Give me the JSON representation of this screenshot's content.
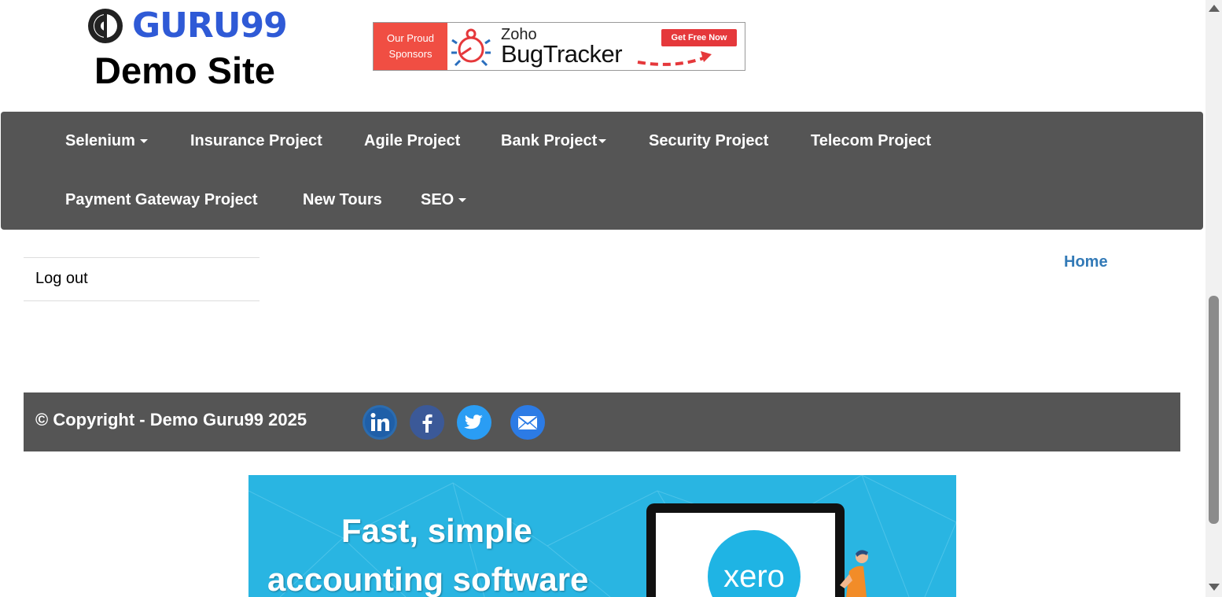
{
  "header": {
    "logo_text": "GURU99",
    "site_title": "Demo Site"
  },
  "sponsor": {
    "line1": "Our Proud",
    "line2": "Sponsors",
    "brand_small": "Zoho",
    "brand_large": "BugTracker",
    "cta": "Get Free Now"
  },
  "nav": {
    "items": [
      {
        "label": "Selenium",
        "dropdown": true
      },
      {
        "label": "Insurance Project",
        "dropdown": false
      },
      {
        "label": "Agile Project",
        "dropdown": false
      },
      {
        "label": "Bank Project",
        "dropdown": true
      },
      {
        "label": "Security Project",
        "dropdown": false
      },
      {
        "label": "Telecom Project",
        "dropdown": false
      },
      {
        "label": "Payment Gateway Project",
        "dropdown": false
      },
      {
        "label": "New Tours",
        "dropdown": false
      },
      {
        "label": "SEO",
        "dropdown": true
      }
    ]
  },
  "sidebar": {
    "logout_label": "Log out"
  },
  "breadcrumb": {
    "home_label": "Home"
  },
  "footer": {
    "copyright": "© Copyright - Demo Guru99 2025",
    "social": [
      "linkedin-icon",
      "facebook-icon",
      "twitter-icon",
      "email-icon"
    ]
  },
  "ad": {
    "line1": "Fast, simple",
    "line2": "accounting software",
    "brand": "xero"
  },
  "colors": {
    "nav_bg": "#555555",
    "link": "#337ab7",
    "logo_blue": "#2f5ad6",
    "sponsor_red": "#f04e43",
    "ad_bg": "#29b5e2"
  }
}
